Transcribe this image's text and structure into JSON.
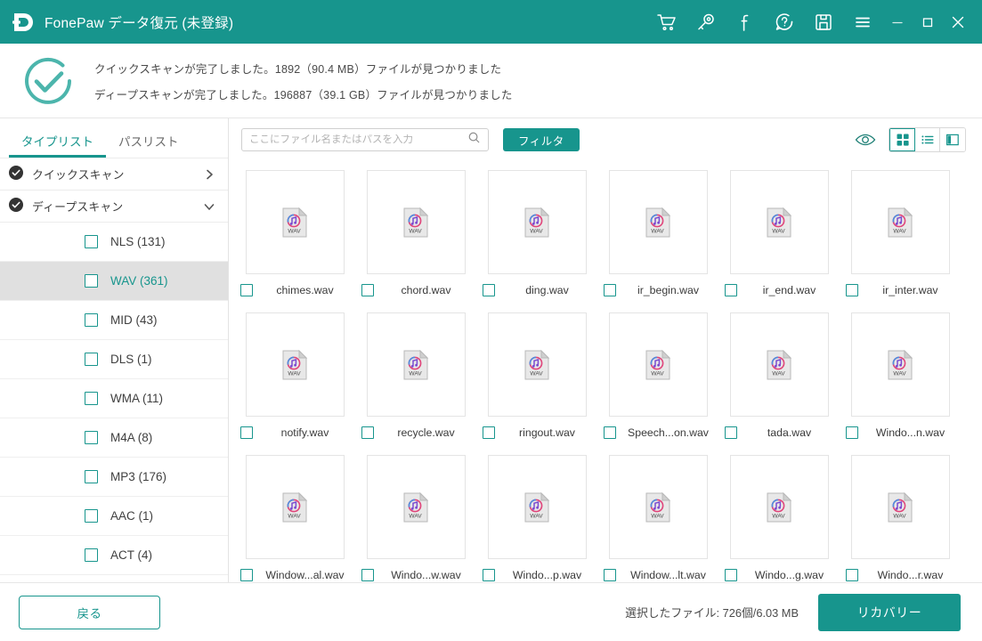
{
  "titlebar": {
    "app_title": "FonePaw データ復元 (未登録)",
    "logo_name": "fonepaw-logo",
    "accent_color": "#17958d",
    "icons": [
      {
        "name": "cart-icon",
        "label": "カート"
      },
      {
        "name": "key-icon",
        "label": "登録"
      },
      {
        "name": "facebook-icon",
        "label": "Facebook"
      },
      {
        "name": "help-icon",
        "label": "ヘルプ"
      },
      {
        "name": "save-icon",
        "label": "保存"
      },
      {
        "name": "menu-icon",
        "label": "メニュー"
      }
    ],
    "window_controls": [
      {
        "name": "minimize-button",
        "label": "最小化"
      },
      {
        "name": "maximize-button",
        "label": "最大化"
      },
      {
        "name": "close-button",
        "label": "閉じる"
      }
    ]
  },
  "status": {
    "icon": "check-circle-icon",
    "line1": "クイックスキャンが完了しました。1892（90.4 MB）ファイルが見つかりました",
    "line2": "ディープスキャンが完了しました。196887（39.1 GB）ファイルが見つかりました"
  },
  "sidebar": {
    "tabs": [
      {
        "label": "タイプリスト",
        "active": true
      },
      {
        "label": "パスリスト",
        "active": false
      }
    ],
    "scans": [
      {
        "label": "クイックスキャン",
        "chevron": "chevron-right-icon"
      },
      {
        "label": "ディープスキャン",
        "chevron": "chevron-down-icon"
      }
    ],
    "types": [
      {
        "label": "NLS (131)",
        "selected": false
      },
      {
        "label": "WAV (361)",
        "selected": true
      },
      {
        "label": "MID (43)",
        "selected": false
      },
      {
        "label": "DLS (1)",
        "selected": false
      },
      {
        "label": "WMA (11)",
        "selected": false
      },
      {
        "label": "M4A (8)",
        "selected": false
      },
      {
        "label": "MP3 (176)",
        "selected": false
      },
      {
        "label": "AAC (1)",
        "selected": false
      },
      {
        "label": "ACT (4)",
        "selected": false
      }
    ]
  },
  "toolbar": {
    "search_placeholder": "ここにファイル名またはパスを入力",
    "search_value": "",
    "search_icon": "search-icon",
    "filter_label": "フィルタ",
    "preview_icon": "eye-icon",
    "views": [
      {
        "name": "grid-view-button",
        "active": true
      },
      {
        "name": "list-view-button",
        "active": false
      },
      {
        "name": "detail-view-button",
        "active": false
      }
    ]
  },
  "files": [
    {
      "name": "chimes.wav",
      "type": "WAV"
    },
    {
      "name": "chord.wav",
      "type": "WAV"
    },
    {
      "name": "ding.wav",
      "type": "WAV"
    },
    {
      "name": "ir_begin.wav",
      "type": "WAV"
    },
    {
      "name": "ir_end.wav",
      "type": "WAV"
    },
    {
      "name": "ir_inter.wav",
      "type": "WAV"
    },
    {
      "name": "notify.wav",
      "type": "WAV"
    },
    {
      "name": "recycle.wav",
      "type": "WAV"
    },
    {
      "name": "ringout.wav",
      "type": "WAV"
    },
    {
      "name": "Speech...on.wav",
      "type": "WAV"
    },
    {
      "name": "tada.wav",
      "type": "WAV"
    },
    {
      "name": "Windo...n.wav",
      "type": "WAV"
    },
    {
      "name": "Window...al.wav",
      "type": "WAV"
    },
    {
      "name": "Windo...w.wav",
      "type": "WAV"
    },
    {
      "name": "Windo...p.wav",
      "type": "WAV"
    },
    {
      "name": "Window...lt.wav",
      "type": "WAV"
    },
    {
      "name": "Windo...g.wav",
      "type": "WAV"
    },
    {
      "name": "Windo...r.wav",
      "type": "WAV"
    }
  ],
  "footer": {
    "back_label": "戻る",
    "selection_info": "選択したファイル: 726個/6.03 MB",
    "recover_label": "リカバリー"
  }
}
